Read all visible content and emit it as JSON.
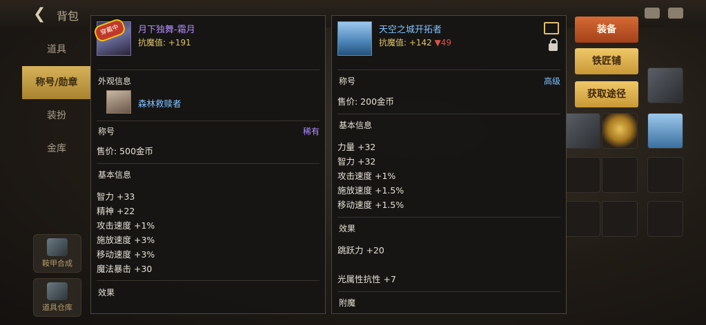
{
  "header": {
    "title": "背包"
  },
  "nav": {
    "items": [
      "道具",
      "称号/勋章",
      "装扮",
      "金库"
    ]
  },
  "side_bottom": [
    "鞍甲合成",
    "道具仓库"
  ],
  "item_left": {
    "badge": "穿戴中",
    "name": "月下独舞-霜月",
    "resist": "抗魔值: +191",
    "appearance_header": "外观信息",
    "appearance_name": "森林救赎者",
    "type": "称号",
    "rarity": "稀有",
    "price": "售价: 500金币",
    "base_header": "基本信息",
    "stats": [
      "智力 +33",
      "精神 +22",
      "攻击速度 +1%",
      "施放速度 +3%",
      "移动速度 +3%",
      "魔法暴击 +30"
    ],
    "effect_header": "效果"
  },
  "item_right": {
    "name": "天空之城开拓者",
    "resist": "抗魔值: +142",
    "resist_diff": "▼49",
    "type": "称号",
    "rarity": "高级",
    "price": "售价: 200金币",
    "base_header": "基本信息",
    "stats": [
      "力量 +32",
      "智力 +32",
      "攻击速度 +1%",
      "施放速度 +1.5%",
      "移动速度 +1.5%"
    ],
    "effect_header": "效果",
    "effects": [
      "跳跃力 +20",
      "光属性抗性 +7"
    ],
    "enchant_header": "附魔"
  },
  "buttons": {
    "equip": "装备",
    "blacksmith": "铁匠铺",
    "obtain": "获取途径"
  },
  "colors": {
    "equip_button": "#c4552a",
    "gold_button": "#e3b24e",
    "name_blue": "#7fc3ff",
    "name_purple": "#b18bff",
    "resist_down": "#e0504a"
  }
}
